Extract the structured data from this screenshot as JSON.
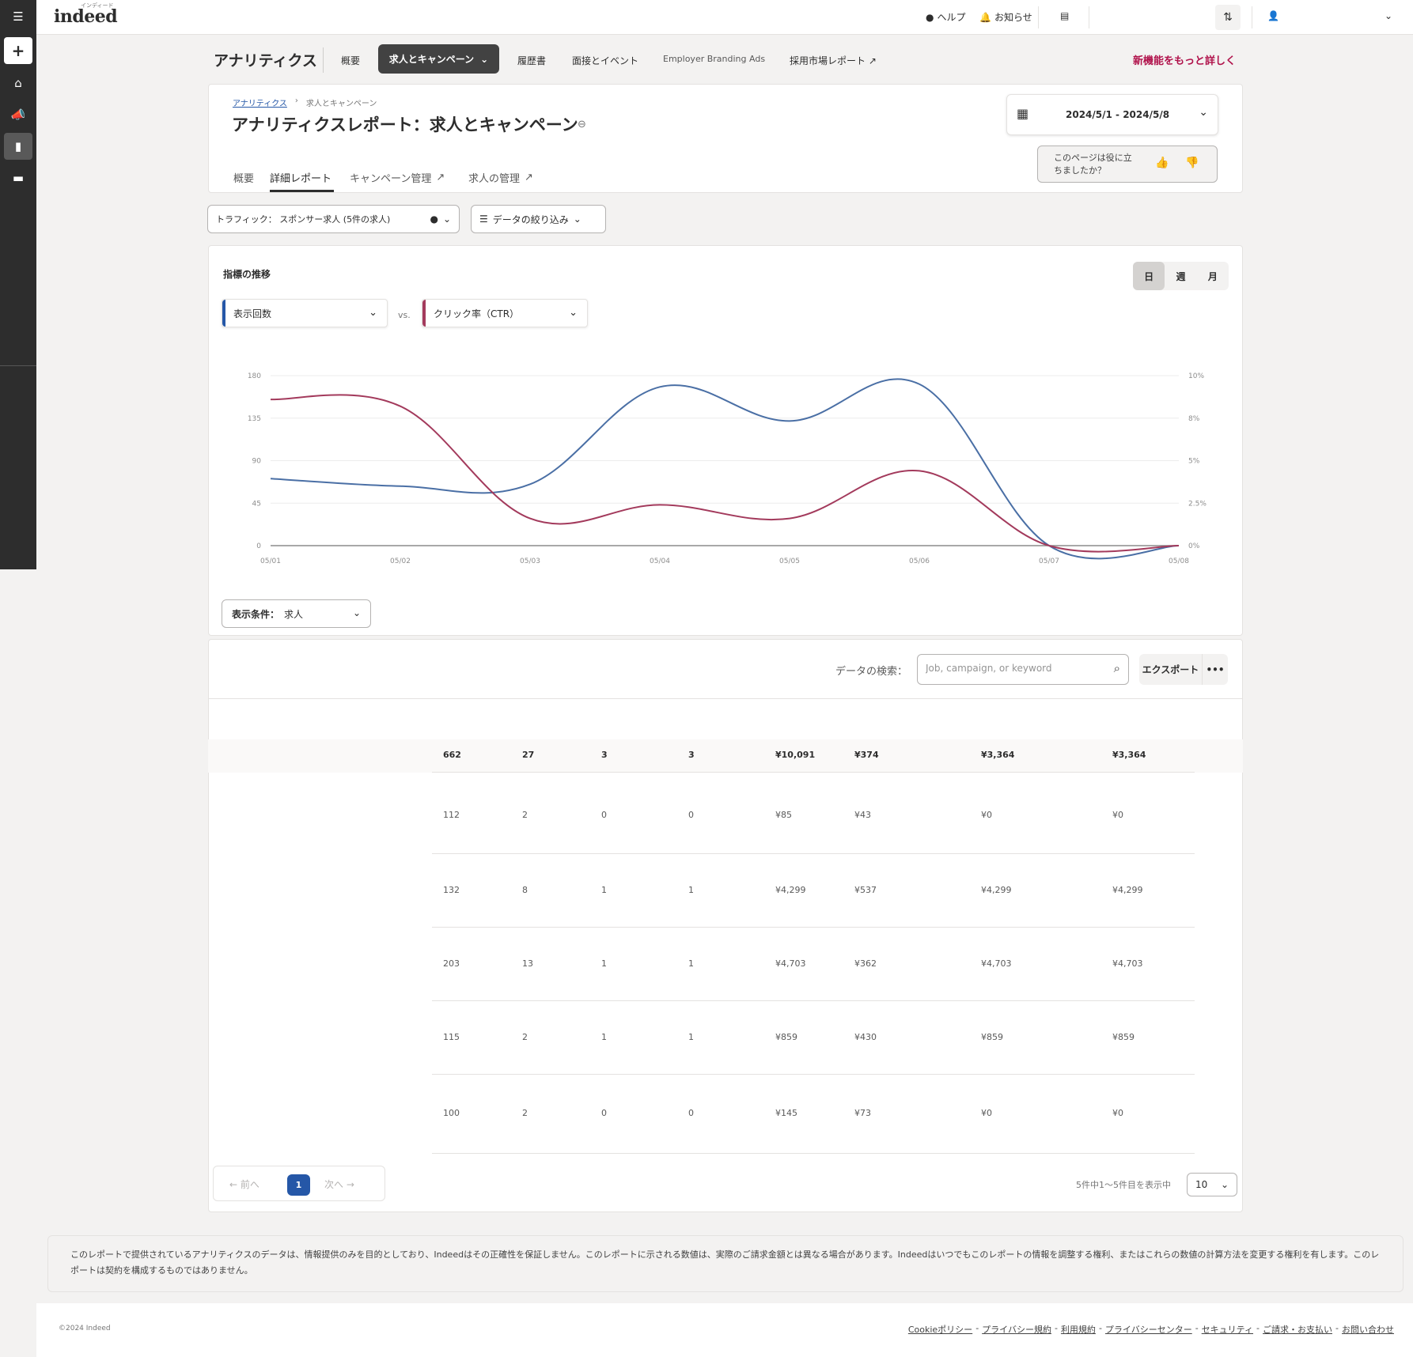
{
  "app": {
    "logo": "indeed",
    "logo_sub": "インディード"
  },
  "topbar": {
    "help": "ヘルプ",
    "notifications": "お知らせ"
  },
  "analytics_nav": {
    "title": "アナリティクス",
    "links": [
      "概要",
      "求人とキャンペーン",
      "履歴書",
      "面接とイベント",
      "Employer Branding Ads",
      "採用市場レポート"
    ],
    "active": "求人とキャンペーン",
    "new_features": "新機能をもっと詳しく"
  },
  "header": {
    "breadcrumb": [
      "アナリティクス",
      "求人とキャンペーン"
    ],
    "title": "アナリティクスレポート：求人とキャンペーン",
    "tabs": [
      "概要",
      "詳細レポート",
      "キャンペーン管理",
      "求人の管理"
    ],
    "active_tab": "詳細レポート",
    "date_range": "2024/5/1 - 2024/5/8",
    "feedback_line1": "このページは役に立",
    "feedback_line2": "ちましたか？"
  },
  "filters": {
    "traffic": "トラフィック： スポンサー求人 (5件の求人)",
    "narrow": "データの絞り込み"
  },
  "chart_section": {
    "title": "指標の推移",
    "granularity": [
      "日",
      "週",
      "月"
    ],
    "granularity_active": "日",
    "metric_left": "表示回数",
    "vs": "vs.",
    "metric_right": "クリック率（CTR）",
    "display_condition_label": "表示条件：",
    "display_condition_value": "求人"
  },
  "chart_data": {
    "type": "line",
    "x": [
      "05/01",
      "05/02",
      "05/03",
      "05/04",
      "05/05",
      "05/06",
      "05/07",
      "05/08"
    ],
    "y_left_ticks": [
      "180",
      "135",
      "90",
      "45",
      "0"
    ],
    "y_right_ticks": [
      "10%",
      "8%",
      "5%",
      "2.5%",
      "0%"
    ],
    "ylim_left": [
      0,
      180
    ],
    "ylim_right": [
      0,
      10
    ],
    "series": [
      {
        "values": [
          71,
          63,
          65,
          168,
          132,
          171,
          0,
          0
        ],
        "color": "#4a6fa5",
        "axis": "left"
      },
      {
        "values": [
          8.6,
          8.2,
          1.6,
          2.4,
          1.6,
          4.4,
          0,
          0
        ],
        "color": "#a33a5c",
        "axis": "right"
      }
    ],
    "grid": true
  },
  "table": {
    "search_label": "データの検索：",
    "search_placeholder": "Job, campaign, or keyword",
    "export": "エクスポート",
    "totals": [
      "662",
      "27",
      "3",
      "3",
      "¥10,091",
      "¥374",
      "¥3,364",
      "¥3,364"
    ],
    "rows": [
      [
        "112",
        "2",
        "0",
        "0",
        "¥85",
        "¥43",
        "¥0",
        "¥0"
      ],
      [
        "132",
        "8",
        "1",
        "1",
        "¥4,299",
        "¥537",
        "¥4,299",
        "¥4,299"
      ],
      [
        "203",
        "13",
        "1",
        "1",
        "¥4,703",
        "¥362",
        "¥4,703",
        "¥4,703"
      ],
      [
        "115",
        "2",
        "1",
        "1",
        "¥859",
        "¥430",
        "¥859",
        "¥859"
      ],
      [
        "100",
        "2",
        "0",
        "0",
        "¥145",
        "¥73",
        "¥0",
        "¥0"
      ]
    ]
  },
  "pagination": {
    "prev": "前へ",
    "page": "1",
    "next": "次へ",
    "range": "5件中1～5件目を表示中",
    "per_page": "10"
  },
  "disclaimer": "このレポートで提供されているアナリティクスのデータは、情報提供のみを目的としており、Indeedはその正確性を保証しません。このレポートに示される数値は、実際のご請求金額とは異なる場合があります。Indeedはいつでもこのレポートの情報を調整する権利、またはこれらの数値の計算方法を変更する権利を有します。このレポートは契約を構成するものではありません。",
  "footer": {
    "copyright": "©2024 Indeed",
    "links": [
      "Cookieポリシー",
      "プライバシー規約",
      "利用規約",
      "プライバシーセンター",
      "セキュリティ",
      "ご請求・お支払い",
      "お問い合わせ"
    ]
  }
}
